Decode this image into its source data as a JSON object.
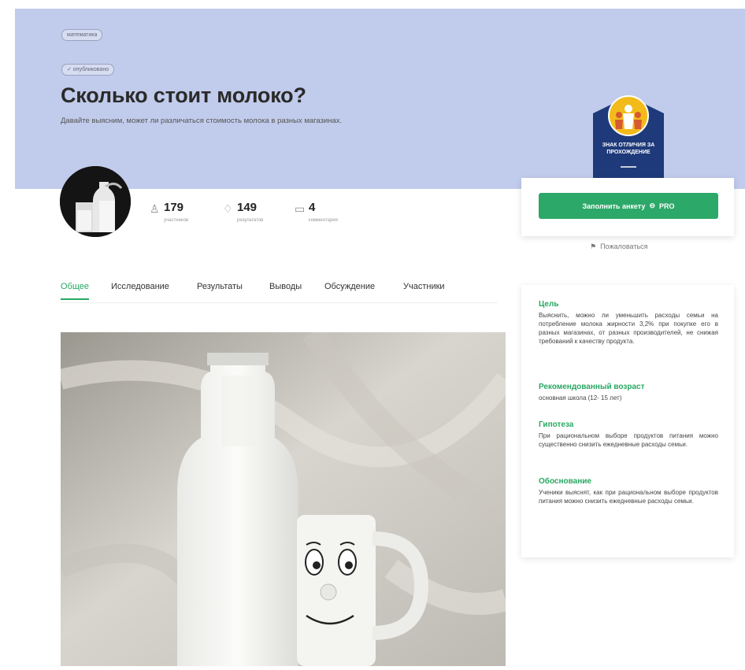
{
  "header": {
    "category_chip": "математика",
    "status_chip": "✓ опубликовано",
    "title": "Сколько стоит молоко?",
    "subtitle": "Давайте выясним, может ли различаться стоимость молока в разных магазинах."
  },
  "badge": {
    "text": "ЗНАК ОТЛИЧИЯ ЗА ПРОХОЖДЕНИЕ",
    "colors": {
      "shield": "#1f3a7a",
      "circle": "#f2bb1a"
    }
  },
  "stats": [
    {
      "icon": "participants-icon",
      "value": "179",
      "label": "участников"
    },
    {
      "icon": "results-icon",
      "value": "149",
      "label": "результатов"
    },
    {
      "icon": "comments-icon",
      "value": "4",
      "label": "комментария"
    }
  ],
  "tabs": [
    {
      "label": "Общее",
      "active": true
    },
    {
      "label": "Исследование",
      "active": false
    },
    {
      "label": "Результаты",
      "active": false
    },
    {
      "label": "Выводы",
      "active": false
    },
    {
      "label": "Обсуждение",
      "active": false
    },
    {
      "label": "Участники",
      "active": false
    }
  ],
  "action": {
    "cta_label": "Заполнить анкету",
    "cta_tag": "PRO",
    "complain_label": "Пожаловаться"
  },
  "info": {
    "goal_title": "Цель",
    "goal_text": "Выяснить, можно ли уменьшить расходы семьи на потребление молока жирности 3,2% при покупке его в разных магазинах, от разных производителей, не снижая требований к качеству продукта.",
    "age_title": "Рекомендованный возраст",
    "age_text": "основная школа (12- 15 лет)",
    "hypothesis_title": "Гипотеза",
    "hypothesis_text": "При рациональном выборе продуктов питания можно существенно снизить ежедневные расходы семьи.",
    "rationale_title": "Обоснование",
    "rationale_text": "Ученики выяснят, как при рациональном выборе продуктов питания можно снизить ежедневные расходы семьи."
  },
  "colors": {
    "hero_bg": "#c1cbeb",
    "accent_green": "#27a862"
  }
}
